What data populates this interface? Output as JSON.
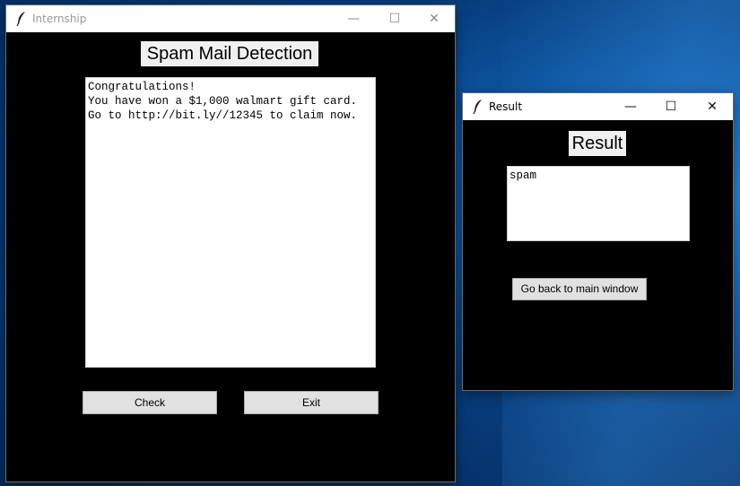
{
  "main_window": {
    "title": "Internship",
    "heading": "Spam Mail Detection",
    "message_lines": [
      "Congratulations!",
      "You have won a $1,000 walmart gift card.",
      "Go to http://bit.ly//12345 to claim now."
    ],
    "check_label": "Check",
    "exit_label": "Exit",
    "controls": {
      "minimize": "—",
      "maximize": "☐",
      "close": "✕"
    }
  },
  "result_window": {
    "title": "Result",
    "heading": "Result",
    "result_text": "spam",
    "back_label": "Go back to main window",
    "controls": {
      "minimize": "—",
      "maximize": "☐",
      "close": "✕"
    }
  }
}
